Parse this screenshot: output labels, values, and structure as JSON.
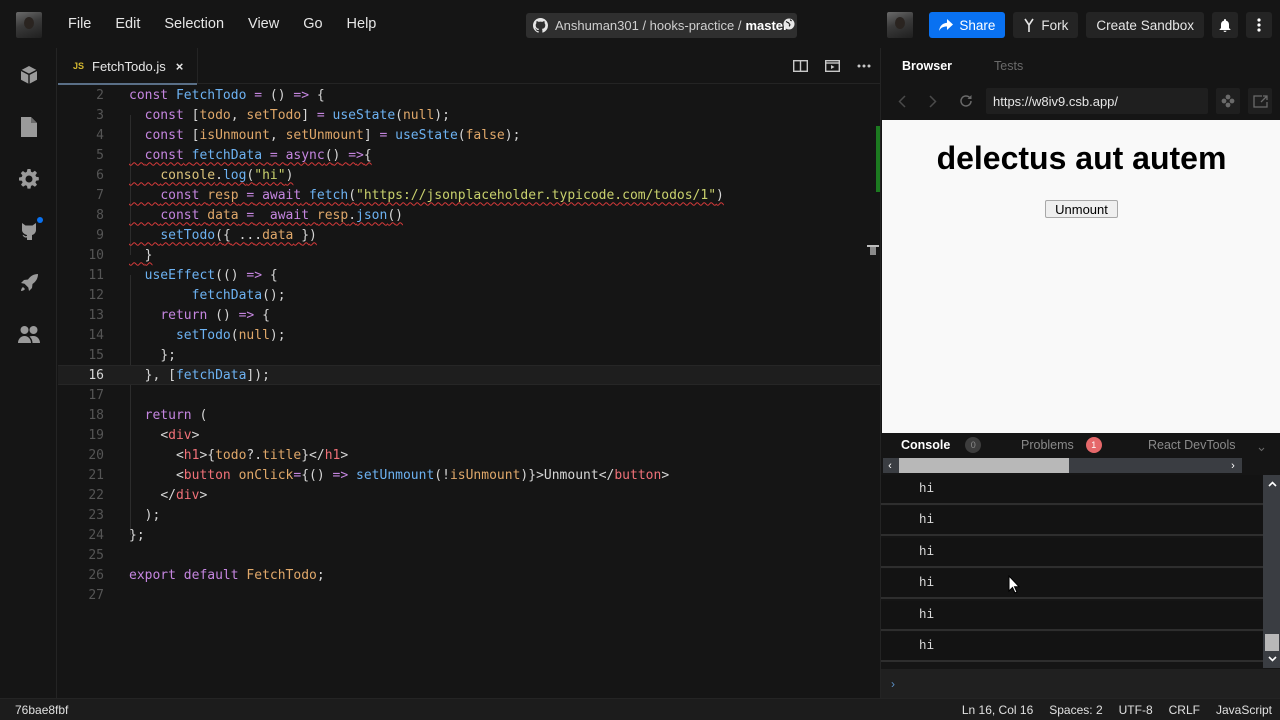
{
  "topbar": {
    "menu": [
      "File",
      "Edit",
      "Selection",
      "View",
      "Go",
      "Help"
    ],
    "repo": {
      "owner_repo": "Anshuman301 / hooks-practice /",
      "branch": "master"
    },
    "share_label": "Share",
    "fork_label": "Fork",
    "create_sandbox_label": "Create Sandbox"
  },
  "activity_bar": {
    "items": [
      "project-info",
      "explorer",
      "config",
      "github",
      "deployment",
      "live"
    ],
    "github_has_notification": true
  },
  "editor": {
    "tab": {
      "badge": "JS",
      "filename": "FetchTodo.js",
      "close": "×"
    },
    "active_line": 16,
    "lines": [
      {
        "n": "2",
        "text": "const FetchTodo = () => {"
      },
      {
        "n": "3",
        "text": "  const [todo, setTodo] = useState(null);"
      },
      {
        "n": "4",
        "text": "  const [isUnmount, setUnmount] = useState(false);"
      },
      {
        "n": "5",
        "text": "  const fetchData = async() =>{"
      },
      {
        "n": "6",
        "text": "    console.log(\"hi\")"
      },
      {
        "n": "7",
        "text": "    const resp = await fetch(\"https://jsonplaceholder.typicode.com/todos/1\")"
      },
      {
        "n": "8",
        "text": "    const data =  await resp.json()"
      },
      {
        "n": "9",
        "text": "    setTodo({ ...data })"
      },
      {
        "n": "10",
        "text": "  }"
      },
      {
        "n": "11",
        "text": "  useEffect(() => {"
      },
      {
        "n": "12",
        "text": "        fetchData();"
      },
      {
        "n": "13",
        "text": "    return () => {"
      },
      {
        "n": "14",
        "text": "      setTodo(null);"
      },
      {
        "n": "15",
        "text": "    };"
      },
      {
        "n": "16",
        "text": "  }, [fetchData]);"
      },
      {
        "n": "17",
        "text": ""
      },
      {
        "n": "18",
        "text": "  return ("
      },
      {
        "n": "19",
        "text": "    <div>"
      },
      {
        "n": "20",
        "text": "      <h1>{todo?.title}</h1>"
      },
      {
        "n": "21",
        "text": "      <button onClick={() => setUnmount(!isUnmount)}>Unmount</button>"
      },
      {
        "n": "22",
        "text": "    </div>"
      },
      {
        "n": "23",
        "text": "  );"
      },
      {
        "n": "24",
        "text": "};"
      },
      {
        "n": "25",
        "text": ""
      },
      {
        "n": "26",
        "text": "export default FetchTodo;"
      },
      {
        "n": "27",
        "text": ""
      }
    ]
  },
  "preview": {
    "tabs": [
      {
        "label": "Browser",
        "active": true
      },
      {
        "label": "Tests",
        "active": false
      }
    ],
    "url": "https://w8iv9.csb.app/",
    "page": {
      "heading": "delectus aut autem",
      "button_label": "Unmount"
    },
    "devtools": {
      "tabs": [
        {
          "label": "Console",
          "count": "0",
          "active": true
        },
        {
          "label": "Problems",
          "count": "1",
          "active": false
        },
        {
          "label": "React DevTools",
          "active": false
        }
      ],
      "console_logs": [
        "hi",
        "hi",
        "hi",
        "hi",
        "hi",
        "hi"
      ],
      "prompt": "›"
    }
  },
  "statusbar": {
    "commit": "76bae8fbf",
    "position": "Ln 16, Col 16",
    "spaces": "Spaces: 2",
    "encoding": "UTF-8",
    "eol": "CRLF",
    "language": "JavaScript"
  },
  "colors": {
    "accent_blue": "#0971f1",
    "problems_badge": "#e5686a",
    "console_badge": "#3d3d3d"
  }
}
